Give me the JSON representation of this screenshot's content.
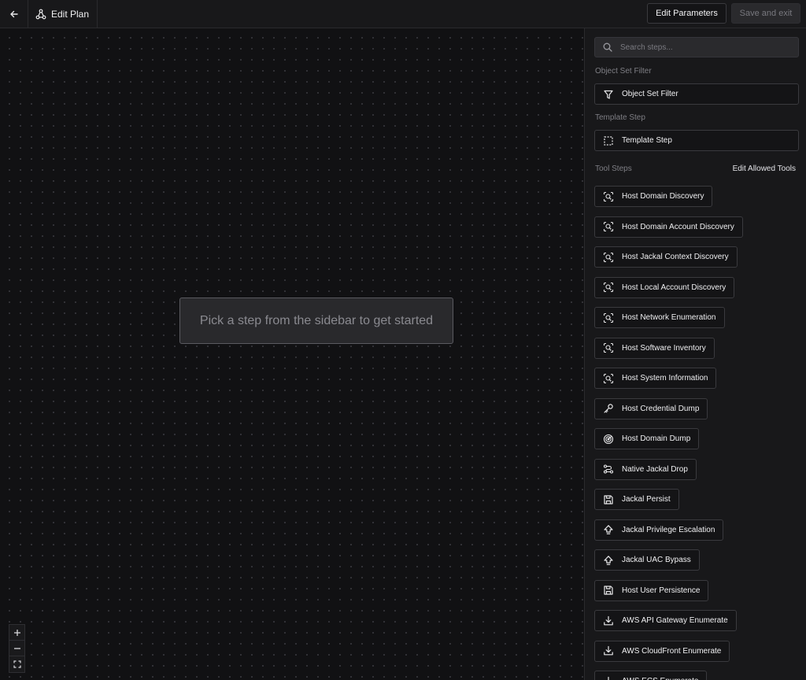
{
  "header": {
    "title": "Edit Plan",
    "edit_parameters_label": "Edit Parameters",
    "save_exit_label": "Save and exit"
  },
  "canvas": {
    "placeholder": "Pick a step from the sidebar to get started"
  },
  "sidebar": {
    "search_placeholder": "Search steps...",
    "object_set_filter_label": "Object Set Filter",
    "object_set_filter_button": "Object Set Filter",
    "template_step_label": "Template Step",
    "template_step_button": "Template Step",
    "tool_steps_label": "Tool Steps",
    "edit_allowed_tools_label": "Edit Allowed Tools",
    "tools": [
      {
        "label": "Host Domain Discovery",
        "icon": "zoom-scan-icon"
      },
      {
        "label": "Host Domain Account Discovery",
        "icon": "zoom-scan-icon"
      },
      {
        "label": "Host Jackal Context Discovery",
        "icon": "zoom-scan-icon"
      },
      {
        "label": "Host Local Account Discovery",
        "icon": "zoom-scan-icon"
      },
      {
        "label": "Host Network Enumeration",
        "icon": "zoom-scan-icon"
      },
      {
        "label": "Host Software Inventory",
        "icon": "zoom-scan-icon"
      },
      {
        "label": "Host System Information",
        "icon": "zoom-scan-icon"
      },
      {
        "label": "Host Credential Dump",
        "icon": "key-icon"
      },
      {
        "label": "Host Domain Dump",
        "icon": "radar-icon"
      },
      {
        "label": "Native Jackal Drop",
        "icon": "route-icon"
      },
      {
        "label": "Jackal Persist",
        "icon": "save-icon"
      },
      {
        "label": "Jackal Privilege Escalation",
        "icon": "arrow-up-icon"
      },
      {
        "label": "Jackal UAC Bypass",
        "icon": "arrow-up-icon"
      },
      {
        "label": "Host User Persistence",
        "icon": "save-icon"
      },
      {
        "label": "AWS API Gateway Enumerate",
        "icon": "download-icon"
      },
      {
        "label": "AWS CloudFront Enumerate",
        "icon": "download-icon"
      },
      {
        "label": "AWS ECS Enumerate",
        "icon": "download-icon"
      }
    ]
  }
}
